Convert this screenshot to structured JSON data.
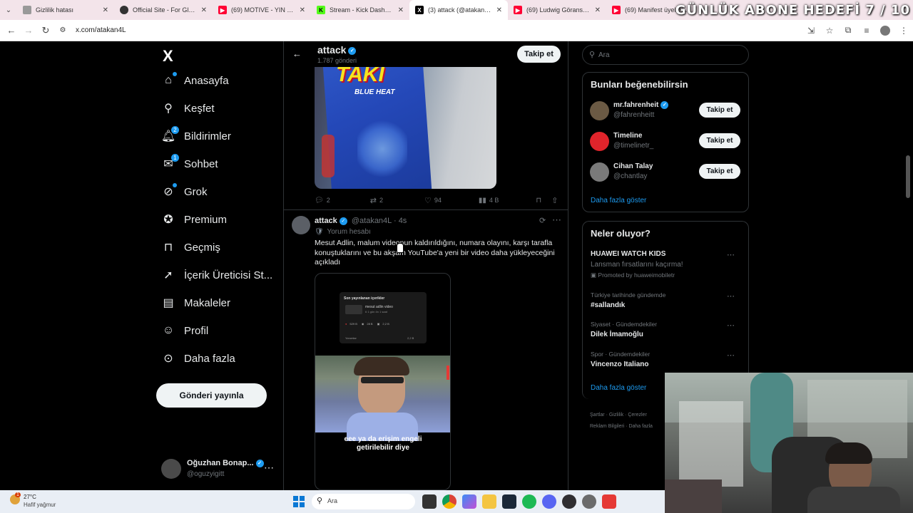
{
  "browser": {
    "tabs": [
      {
        "title": "Gizlilik hatası",
        "icon": "warning-icon",
        "color": "#999999"
      },
      {
        "title": "Official Site - For Glory | S",
        "icon": "site-icon",
        "color": "#333333"
      },
      {
        "title": "(69) MOTIVE - YIN YANG",
        "icon": "youtube-icon",
        "color": "#ff0033"
      },
      {
        "title": "Stream - Kick Dashboard",
        "icon": "kick-icon",
        "color": "#53fc18"
      },
      {
        "title": "(3) attack (@atakan4L) / X",
        "icon": "x-icon",
        "color": "#000000"
      },
      {
        "title": "(69) Ludwig Göransson: T",
        "icon": "youtube-icon",
        "color": "#ff0033"
      },
      {
        "title": "(69) Manifest üyelerinin e",
        "icon": "youtube-icon",
        "color": "#ff0033"
      }
    ],
    "overlay_text": "GÜNLÜK ABONE HEDEFİ 7 / 10",
    "url": "x.com/atakan4L"
  },
  "nav": {
    "logo": "X",
    "items": [
      {
        "label": "Anasayfa",
        "icon": "home-icon",
        "badge": "",
        "dot": true
      },
      {
        "label": "Keşfet",
        "icon": "search-icon",
        "badge": "",
        "dot": false
      },
      {
        "label": "Bildirimler",
        "icon": "bell-icon",
        "badge": "2",
        "dot": false
      },
      {
        "label": "Sohbet",
        "icon": "chat-icon",
        "badge": "1",
        "dot": false
      },
      {
        "label": "Grok",
        "icon": "grok-icon",
        "badge": "",
        "dot": true
      },
      {
        "label": "Premium",
        "icon": "premium-icon",
        "badge": "",
        "dot": false
      },
      {
        "label": "Geçmiş",
        "icon": "bookmark-icon",
        "badge": "",
        "dot": false
      },
      {
        "label": "İçerik Üreticisi St...",
        "icon": "rocket-icon",
        "badge": "",
        "dot": false
      },
      {
        "label": "Makaleler",
        "icon": "article-icon",
        "badge": "",
        "dot": false
      },
      {
        "label": "Profil",
        "icon": "profile-icon",
        "badge": "",
        "dot": false
      },
      {
        "label": "Daha fazla",
        "icon": "more-circle-icon",
        "badge": "",
        "dot": false
      }
    ],
    "post_button": "Gönderi yayınla",
    "account": {
      "name": "Oğuzhan Bonap...",
      "handle": "@oguzyigitt"
    }
  },
  "main": {
    "header": {
      "name": "attack",
      "posts": "1.787 gönderi",
      "follow": "Takip et"
    },
    "post1": {
      "image_text_top": "TAKI",
      "image_text_sub": "BLUE HEAT",
      "replies": "2",
      "reposts": "2",
      "likes": "94",
      "views": "4 B"
    },
    "post2": {
      "name": "attack",
      "handle": "@atakan4L",
      "time": "4s",
      "badge": "Yorum hesabı",
      "text": "Mesut Adlin, malum videonun kaldırıldığını, numara olayını, karşı tarafla konuştuklarını ve bu akşam YouTube'a yeni bir video daha yükleyeceğini açıkladı",
      "media": {
        "panel_title": "Son yayınlanan içerikler",
        "video_title": "mesut adlin video",
        "video_sub": "6 1 gün ön 1 saat",
        "stats": [
          "529 B",
          "28 B",
          "2,2 B"
        ],
        "comments_label": "Yorumlar",
        "comments_count": "2,2 B",
        "caption": "eee ya da erişim engeli getirilebilir diye"
      }
    }
  },
  "right": {
    "search_placeholder": "Ara",
    "suggest_title": "Bunları beğenebilirsin",
    "suggestions": [
      {
        "name": "mr.fahrenheit",
        "handle": "@fahrenheitt",
        "verified": true,
        "button": "Takip et",
        "avatar_color": "#6b5a44"
      },
      {
        "name": "Timeline",
        "handle": "@timelinetr_",
        "verified": false,
        "button": "Takip et",
        "avatar_color": "#e0242b"
      },
      {
        "name": "Cihan Talay",
        "handle": "@chantlay",
        "verified": false,
        "button": "Takip et",
        "avatar_color": "#7a7a7a"
      }
    ],
    "show_more": "Daha fazla göster",
    "trends_title": "Neler oluyor?",
    "trends": [
      {
        "context": "",
        "title": "HUAWEI WATCH KIDS",
        "sub": "Lansman fırsatlarını kaçırma!",
        "promo": "Promoted by huaweimobiletr"
      },
      {
        "context": "Türkiye tarihinde gündemde",
        "title": "#sallandık",
        "sub": "",
        "promo": ""
      },
      {
        "context": "Siyaset · Gündemdekiler",
        "title": "Dilek İmamoğlu",
        "sub": "",
        "promo": ""
      },
      {
        "context": "Spor · Gündemdekiler",
        "title": "Vincenzo Italiano",
        "sub": "",
        "promo": ""
      }
    ],
    "show_more2": "Daha fazla göster",
    "footer": [
      "Şartlar",
      "Gizlilik",
      "Çerezler",
      "Reklam Bilgileri",
      "Daha fazla"
    ]
  },
  "taskbar": {
    "weather_temp": "27°C",
    "weather_desc": "Hafif yağmur",
    "weather_badge": "1",
    "search": "Ara"
  },
  "colors": {
    "accent": "#1d9bf0",
    "bg": "#000000",
    "border": "#2f3336",
    "muted": "#71767b"
  }
}
